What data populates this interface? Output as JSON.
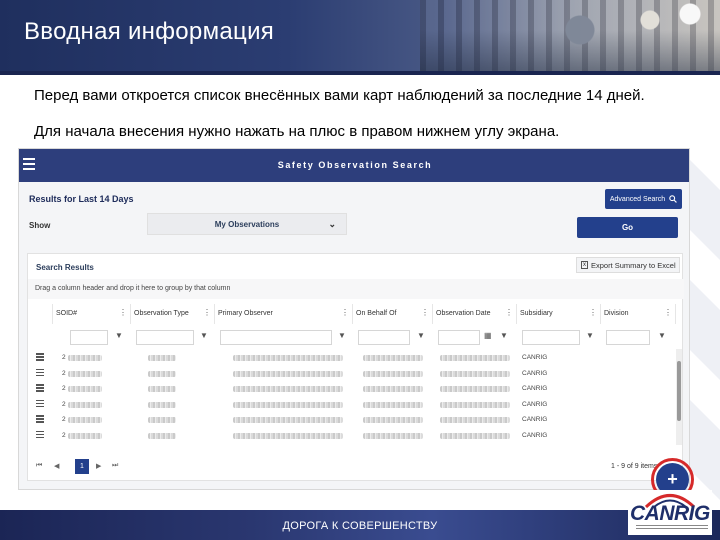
{
  "slide": {
    "title": "Вводная информация",
    "paragraph1": "Перед вами откроется список внесённых вами карт наблюдений за последние 14 дней.",
    "paragraph2": "Для начала внесения нужно нажать на плюс в правом нижнем углу экрана.",
    "footer": "ДОРОГА К СОВЕРШЕНСТВУ",
    "logo_text": "CANRIG",
    "brand_color": "#2d3e7c",
    "highlight_color": "#d62a2a"
  },
  "app": {
    "header_title": "Safety Observation Search",
    "results_title": "Results for Last 14 Days",
    "advanced_search": "Advanced Search",
    "show_label": "Show",
    "show_value": "My Observations",
    "go_label": "Go",
    "search_results_title": "Search Results",
    "export_label": "Export Summary to Excel",
    "drag_hint": "Drag a column header and drop it here to group by that column",
    "columns": [
      "SOID#",
      "Observation Type",
      "Primary Observer",
      "On Behalf Of",
      "Observation Date",
      "Subsidiary",
      "Division"
    ],
    "rows": [
      {
        "id": "2",
        "subsidiary": "CANRIG"
      },
      {
        "id": "2",
        "subsidiary": "CANRIG"
      },
      {
        "id": "2",
        "subsidiary": "CANRIG"
      },
      {
        "id": "2",
        "subsidiary": "CANRIG"
      },
      {
        "id": "2",
        "subsidiary": "CANRIG"
      },
      {
        "id": "2",
        "subsidiary": "CANRIG"
      }
    ],
    "current_page": "1",
    "pager_info": "1 - 9 of 9 items",
    "fab_label": "+"
  }
}
